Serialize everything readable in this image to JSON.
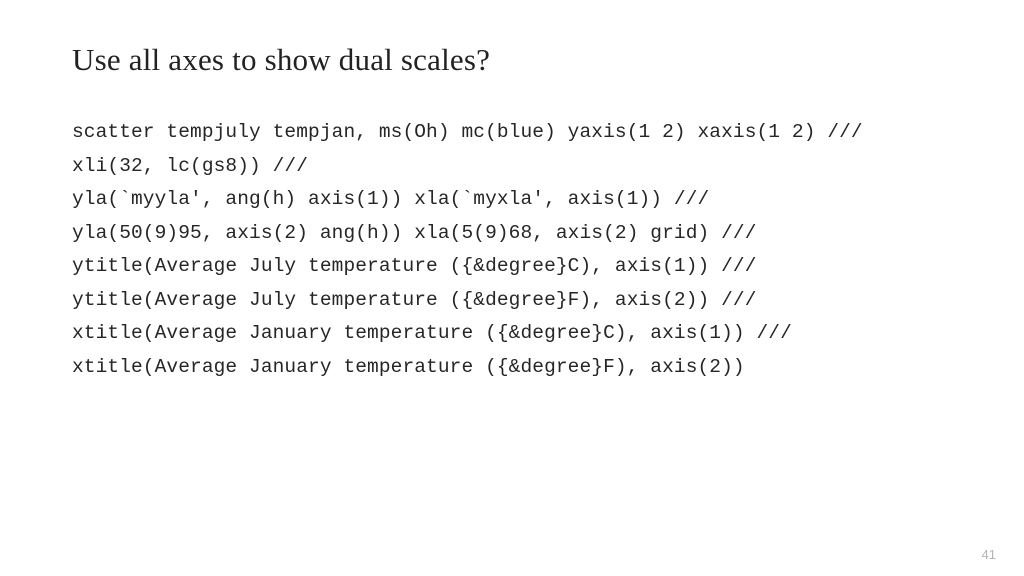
{
  "title": "Use all axes to show dual scales?",
  "code": {
    "l1": "scatter tempjuly tempjan, ms(Oh) mc(blue) yaxis(1 2) xaxis(1 2) ///",
    "l2": "xli(32, lc(gs8)) ///",
    "l3": "yla(`myyla', ang(h) axis(1)) xla(`myxla', axis(1)) ///",
    "l4": "yla(50(9)95, axis(2) ang(h)) xla(5(9)68, axis(2) grid) ///",
    "l5": "ytitle(Average July temperature ({&degree}C), axis(1)) ///",
    "l6": "ytitle(Average July temperature ({&degree}F), axis(2)) ///",
    "l7": "xtitle(Average January temperature ({&degree}C), axis(1)) ///",
    "l8": "xtitle(Average January temperature ({&degree}F), axis(2))"
  },
  "page_number": "41"
}
